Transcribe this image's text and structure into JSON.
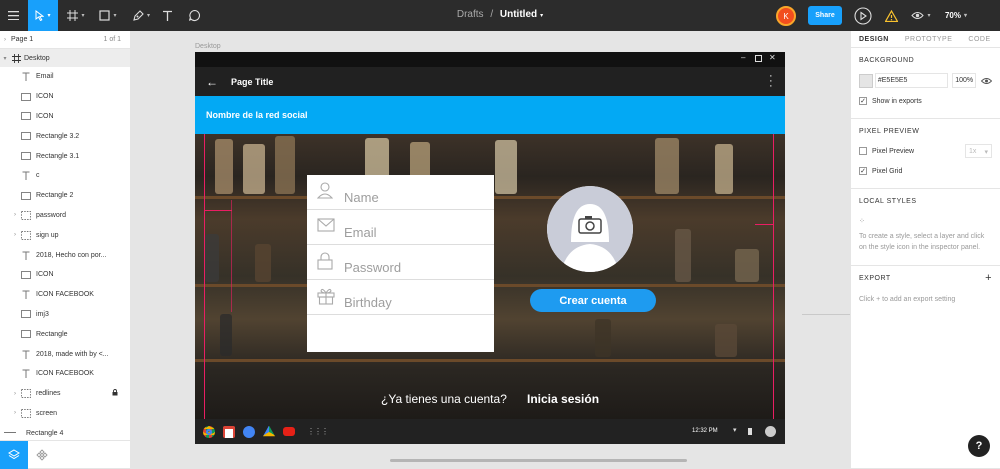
{
  "toolbar": {
    "breadcrumb": "Drafts",
    "separator": "/",
    "file_title": "Untitled",
    "user_initial": "K",
    "share_label": "Share",
    "zoom": "70%"
  },
  "colors": {
    "accent": "#18A0FB",
    "app_blue": "#03A9F4",
    "cta_blue": "#1E9BF0",
    "redline": "#E91E63",
    "avatar": "#F24E1E"
  },
  "layers_panel": {
    "page_label": "Page 1",
    "page_count": "1 of 1",
    "frame_name": "Desktop",
    "layers": [
      {
        "label": "Email",
        "icon": "text-icon",
        "arrow": ""
      },
      {
        "label": "ICON",
        "icon": "rectangle-icon",
        "arrow": ""
      },
      {
        "label": "ICON",
        "icon": "rectangle-icon",
        "arrow": ""
      },
      {
        "label": "Rectangle 3.2",
        "icon": "rectangle-icon",
        "arrow": ""
      },
      {
        "label": "Rectangle 3.1",
        "icon": "rectangle-icon",
        "arrow": ""
      },
      {
        "label": "c",
        "icon": "text-icon",
        "arrow": ""
      },
      {
        "label": "Rectangle 2",
        "icon": "rectangle-icon",
        "arrow": ""
      },
      {
        "label": "password",
        "icon": "group-icon",
        "arrow": "›"
      },
      {
        "label": "sign up",
        "icon": "group-icon",
        "arrow": "›"
      },
      {
        "label": " 2018, Hecho con  por...",
        "icon": "text-icon",
        "arrow": ""
      },
      {
        "label": "ICON",
        "icon": "rectangle-icon",
        "arrow": ""
      },
      {
        "label": "ICON FACEBOOK",
        "icon": "text-icon",
        "arrow": ""
      },
      {
        "label": "imj3",
        "icon": "rectangle-icon",
        "arrow": ""
      },
      {
        "label": "Rectangle",
        "icon": "rectangle-icon",
        "arrow": ""
      },
      {
        "label": " 2018, made with  by <...",
        "icon": "text-icon",
        "arrow": ""
      },
      {
        "label": "ICON FACEBOOK",
        "icon": "text-icon",
        "arrow": ""
      },
      {
        "label": "redlines",
        "icon": "group-icon",
        "arrow": "›",
        "locked": true
      },
      {
        "label": "screen",
        "icon": "group-icon",
        "arrow": "›"
      }
    ],
    "root_layer": "Rectangle 4"
  },
  "inspector": {
    "tabs": [
      "DESIGN",
      "PROTOTYPE",
      "CODE"
    ],
    "background": {
      "title": "BACKGROUND",
      "hex": "#E5E5E5",
      "opacity": "100%",
      "show_in_exports": "Show in exports"
    },
    "pixel_preview": {
      "title": "PIXEL PREVIEW",
      "pixel_preview_label": "Pixel Preview",
      "scale": "1x",
      "pixel_grid_label": "Pixel Grid"
    },
    "local_styles": {
      "title": "LOCAL STYLES",
      "hint": "To create a style, select a layer and click on the style icon in the inspector panel."
    },
    "export": {
      "title": "EXPORT",
      "hint": "Click + to add an export setting"
    }
  },
  "canvas": {
    "frame_label": "Desktop",
    "app": {
      "page_title": "Page Title",
      "network_name": "Nombre de la red social",
      "fields": [
        {
          "placeholder": "Name",
          "icon": "user-icon"
        },
        {
          "placeholder": "Email",
          "icon": "mail-icon"
        },
        {
          "placeholder": "Password",
          "icon": "lock-icon"
        },
        {
          "placeholder": "Birthday",
          "icon": "gift-icon"
        }
      ],
      "cta_label": "Crear cuenta",
      "question": "¿Ya tienes una cuenta?",
      "login_label": "Inicia sesión",
      "clock": "12:32 PM"
    }
  }
}
